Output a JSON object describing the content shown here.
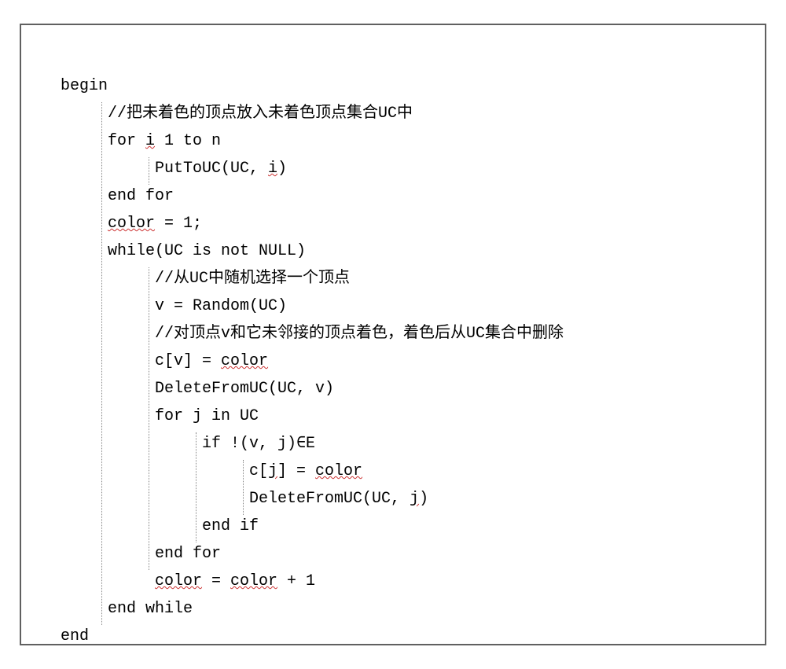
{
  "code": {
    "lines": [
      {
        "indent": 0,
        "parts": [
          {
            "text": "begin"
          }
        ]
      },
      {
        "indent": 1,
        "parts": [
          {
            "text": "//把未着色的顶点放入未着色顶点集合UC中"
          }
        ]
      },
      {
        "indent": 1,
        "parts": [
          {
            "text": "for "
          },
          {
            "text": "i",
            "wavy": true
          },
          {
            "text": " 1 to n"
          }
        ]
      },
      {
        "indent": 2,
        "parts": [
          {
            "text": "PutToUC(UC, "
          },
          {
            "text": "i",
            "wavy": true
          },
          {
            "text": ")"
          }
        ]
      },
      {
        "indent": 1,
        "parts": [
          {
            "text": "end for"
          }
        ]
      },
      {
        "indent": 1,
        "parts": [
          {
            "text": "color",
            "wavy": true
          },
          {
            "text": " = 1;"
          }
        ]
      },
      {
        "indent": 1,
        "parts": [
          {
            "text": "while(UC is not NULL)"
          }
        ]
      },
      {
        "indent": 2,
        "parts": [
          {
            "text": "//从UC中随机选择一个顶点"
          }
        ]
      },
      {
        "indent": 2,
        "parts": [
          {
            "text": "v = Random(UC)"
          }
        ]
      },
      {
        "indent": 2,
        "parts": [
          {
            "text": "//对顶点v和它未邻接的顶点着色，着色后从UC集合中删除"
          }
        ]
      },
      {
        "indent": 2,
        "parts": [
          {
            "text": "c[v] = "
          },
          {
            "text": "color",
            "wavy": true
          }
        ]
      },
      {
        "indent": 2,
        "parts": [
          {
            "text": "DeleteFromUC(UC, v)"
          }
        ]
      },
      {
        "indent": 2,
        "parts": [
          {
            "text": "for j in UC"
          }
        ]
      },
      {
        "indent": 3,
        "parts": [
          {
            "text": "if !(v, j)∈E"
          }
        ]
      },
      {
        "indent": 4,
        "parts": [
          {
            "text": "c["
          },
          {
            "text": "j",
            "wavy": true
          },
          {
            "text": "] = "
          },
          {
            "text": "color",
            "wavy": true
          }
        ]
      },
      {
        "indent": 4,
        "parts": [
          {
            "text": "DeleteFromUC(UC, "
          },
          {
            "text": "j",
            "wavy": true
          },
          {
            "text": ")"
          }
        ]
      },
      {
        "indent": 3,
        "parts": [
          {
            "text": "end if"
          }
        ]
      },
      {
        "indent": 2,
        "parts": [
          {
            "text": "end for"
          }
        ]
      },
      {
        "indent": 2,
        "parts": [
          {
            "text": "color",
            "wavy": true
          },
          {
            "text": " = "
          },
          {
            "text": "color",
            "wavy": true
          },
          {
            "text": " + 1"
          }
        ]
      },
      {
        "indent": 1,
        "parts": [
          {
            "text": "end while"
          }
        ]
      },
      {
        "indent": 0,
        "parts": [
          {
            "text": "end"
          }
        ]
      }
    ]
  }
}
